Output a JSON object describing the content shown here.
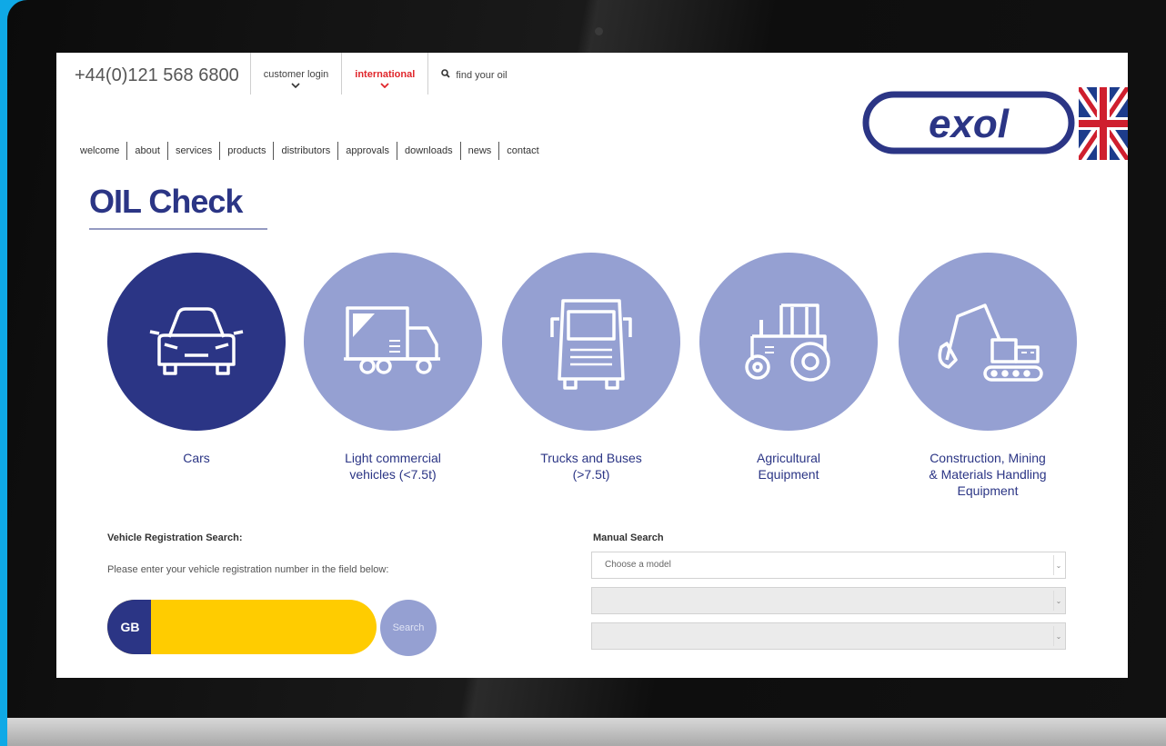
{
  "header": {
    "phone": "+44(0)121 568 6800",
    "customer_login": "customer login",
    "international": "international",
    "find_oil": "find your oil"
  },
  "logo": {
    "text": "exol"
  },
  "nav": [
    "welcome",
    "about",
    "services",
    "products",
    "distributors",
    "approvals",
    "downloads",
    "news",
    "contact"
  ],
  "page": {
    "title": "OIL Check"
  },
  "categories": [
    {
      "line1": "Cars",
      "line2": "",
      "line3": "",
      "icon": "car-icon",
      "active": true
    },
    {
      "line1": "Light commercial",
      "line2": "vehicles (<7.5t)",
      "line3": "",
      "icon": "van-icon",
      "active": false
    },
    {
      "line1": "Trucks and Buses",
      "line2": "(>7.5t)",
      "line3": "",
      "icon": "truck-icon",
      "active": false
    },
    {
      "line1": "Agricultural",
      "line2": "Equipment",
      "line3": "",
      "icon": "tractor-icon",
      "active": false
    },
    {
      "line1": "Construction, Mining",
      "line2": "& Materials Handling",
      "line3": "Equipment",
      "icon": "excavator-icon",
      "active": false
    }
  ],
  "vehicle_search": {
    "title": "Vehicle Registration Search:",
    "instructions": "Please enter your vehicle registration number in the field below:",
    "country_code": "GB",
    "value": "",
    "button": "Search"
  },
  "manual_search": {
    "title": "Manual Search",
    "model_placeholder": "Choose a model",
    "select2_value": "",
    "select3_value": ""
  },
  "colors": {
    "primary": "#2b3585",
    "category_inactive": "#95a0d2",
    "reg_plate": "#ffcc00",
    "accent_red": "#e0262b",
    "backdrop": "#0fa9e6"
  }
}
